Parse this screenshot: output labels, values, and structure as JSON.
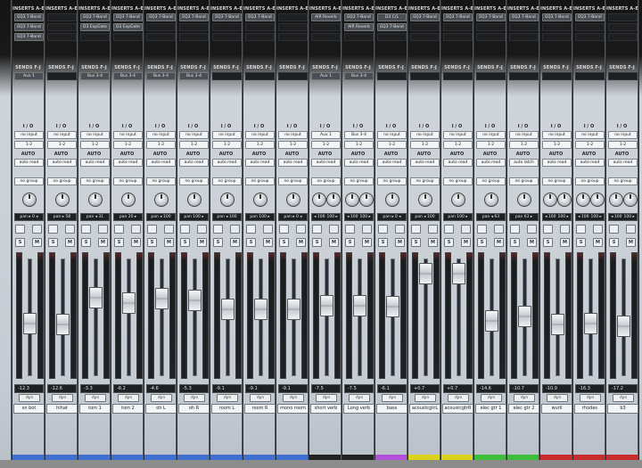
{
  "section_labels": {
    "inserts": "INSERTS A-E",
    "sends": "SENDS F-J",
    "io": "I / O",
    "auto": "AUTO",
    "solo": "S",
    "mute": "M",
    "dyn": "dyn"
  },
  "colors": {
    "accent_blue": "#3f6fd0",
    "purple": "#b44fd9",
    "yellow": "#d8d21a",
    "green": "#3ebd3a",
    "red": "#c92c2c",
    "dark": "#222"
  },
  "channels": [
    {
      "inserts": [
        "EQ3 7-Band",
        "EQ3 7-Band",
        "EQ3 7-Band"
      ],
      "send": "Aux 1",
      "input": "no input",
      "output": "1-2",
      "auto": "auto read",
      "group": "no group",
      "pan": [
        "pan ▸ 0 ◂"
      ],
      "volume": "-12.3",
      "name": "sn bot",
      "color": "#3f6fd0",
      "fader": 0.55
    },
    {
      "inserts": [],
      "send": "",
      "input": "no input",
      "output": "1-2",
      "auto": "auto read",
      "group": "no group",
      "pan": [
        "pan ▸ 58"
      ],
      "volume": "-12.6",
      "name": "hihat",
      "color": "#3f6fd0",
      "fader": 0.56
    },
    {
      "inserts": [
        "EQ3 7-Band",
        "D3 ExpGate"
      ],
      "send": "Bus 3-4",
      "input": "no input",
      "output": "1-2",
      "auto": "auto read",
      "group": "no group",
      "pan": [
        "pan ◂ 31"
      ],
      "volume": "-3.3",
      "name": "tom 1",
      "color": "#3f6fd0",
      "fader": 0.33
    },
    {
      "inserts": [
        "EQ3 7-Band",
        "D3 ExpGate"
      ],
      "send": "Bus 3-4",
      "input": "no input",
      "output": "1-2",
      "auto": "auto read",
      "group": "no group",
      "pan": [
        "pan 20 ▸"
      ],
      "volume": "-8.2",
      "name": "tom 2",
      "color": "#3f6fd0",
      "fader": 0.38
    },
    {
      "inserts": [
        "EQ3 7-Band"
      ],
      "send": "Bus 3-4",
      "input": "no input",
      "output": "1-2",
      "auto": "auto read",
      "group": "no group",
      "pan": [
        "pan ◂ 100"
      ],
      "volume": "-4.6",
      "name": "oh L",
      "color": "#3f6fd0",
      "fader": 0.34
    },
    {
      "inserts": [
        "EQ3 7-Band"
      ],
      "send": "Bus 3-4",
      "input": "no input",
      "output": "1-2",
      "auto": "auto read",
      "group": "no group",
      "pan": [
        "pan 100 ▸"
      ],
      "volume": "-5.3",
      "name": "oh R",
      "color": "#3f6fd0",
      "fader": 0.35
    },
    {
      "inserts": [
        "EQ3 7-Band"
      ],
      "send": "",
      "input": "no input",
      "output": "1-2",
      "auto": "auto read",
      "group": "no group",
      "pan": [
        "pan ◂ 100"
      ],
      "volume": "-9.1",
      "name": "room L",
      "color": "#3f6fd0",
      "fader": 0.43
    },
    {
      "inserts": [
        "EQ3 7-Band"
      ],
      "send": "",
      "input": "no input",
      "output": "1-2",
      "auto": "auto read",
      "group": "no group",
      "pan": [
        "pan 100 ▸"
      ],
      "volume": "-9.1",
      "name": "room R",
      "color": "#3f6fd0",
      "fader": 0.43
    },
    {
      "inserts": [],
      "send": "",
      "input": "no input",
      "output": "1-2",
      "auto": "auto read",
      "group": "no group",
      "pan": [
        "pan ▸ 0 ◂"
      ],
      "volume": "-9.1",
      "name": "mono room",
      "color": "#3f6fd0",
      "fader": 0.43
    },
    {
      "inserts": [
        "AIR Reverb"
      ],
      "send": "Aux 1",
      "input": "Aux 1",
      "output": "1-2",
      "auto": "auto read",
      "group": "no group",
      "pan": [
        "◂ 100",
        "100 ▸"
      ],
      "volume": "-7.5",
      "name": "short verb",
      "color": "#222",
      "fader": 0.4
    },
    {
      "inserts": [
        "EQ3 7-Band",
        "AIR Reverb"
      ],
      "send": "Bus 3-4",
      "input": "Bus 3-4",
      "output": "1-2",
      "auto": "auto read",
      "group": "no group",
      "pan": [
        "◂ 100",
        "100 ▸"
      ],
      "volume": "-7.5",
      "name": "Long verb",
      "color": "#222",
      "fader": 0.4
    },
    {
      "inserts": [
        "D3 C/L",
        "EQ3 7-Band"
      ],
      "send": "",
      "input": "no input",
      "output": "1-2",
      "auto": "auto read",
      "group": "no group",
      "pan": [
        "pan ▸ 0 ◂"
      ],
      "volume": "-6.1",
      "name": "bass",
      "color": "#b44fd9",
      "fader": 0.41
    },
    {
      "inserts": [
        "EQ3 7-Band"
      ],
      "send": "",
      "input": "no input",
      "output": "1-2",
      "auto": "auto read",
      "group": "no group",
      "pan": [
        "pan ◂ 100"
      ],
      "volume": "+0.7",
      "name": "acoustcgtrL",
      "color": "#d8d21a",
      "fader": 0.12
    },
    {
      "inserts": [
        "EQ3 7-Band"
      ],
      "send": "",
      "input": "no input",
      "output": "1-2",
      "auto": "auto read",
      "group": "no group",
      "pan": [
        "pan 100 ▸"
      ],
      "volume": "+0.7",
      "name": "acoustcgtrR",
      "color": "#d8d21a",
      "fader": 0.12
    },
    {
      "inserts": [
        "EQ3 7-Band"
      ],
      "send": "",
      "input": "no input",
      "output": "1-2",
      "auto": "auto read",
      "group": "no group",
      "pan": [
        "pan ◂ 63"
      ],
      "volume": "-14.6",
      "name": "elec gtr 1",
      "color": "#3ebd3a",
      "fader": 0.53
    },
    {
      "inserts": [
        "EQ3 7-Band"
      ],
      "send": "",
      "input": "no input",
      "output": "1-2",
      "auto": "auto latch",
      "group": "no group",
      "pan": [
        "pan 63 ▸"
      ],
      "volume": "-10.7",
      "name": "elec gtr 2",
      "color": "#3ebd3a",
      "fader": 0.49
    },
    {
      "inserts": [
        "EQ3 7-Band"
      ],
      "send": "",
      "input": "no input",
      "output": "1-2",
      "auto": "auto read",
      "group": "no group",
      "pan": [
        "◂ 100",
        "100 ▸"
      ],
      "volume": "-10.9",
      "name": "wurli",
      "color": "#c92c2c",
      "fader": 0.56
    },
    {
      "inserts": [
        "EQ3 7-Band"
      ],
      "send": "",
      "input": "no input",
      "output": "1-2",
      "auto": "auto read",
      "group": "no group",
      "pan": [
        "◂ 100",
        "100 ▸"
      ],
      "volume": "-16.3",
      "name": "rhodes",
      "color": "#c92c2c",
      "fader": 0.55
    },
    {
      "inserts": [],
      "send": "",
      "input": "no input",
      "output": "1-2",
      "auto": "auto read",
      "group": "no group",
      "pan": [
        "◂ 100",
        "100 ▸"
      ],
      "volume": "-17.2",
      "name": "b3",
      "color": "#c92c2c",
      "fader": 0.58
    }
  ]
}
